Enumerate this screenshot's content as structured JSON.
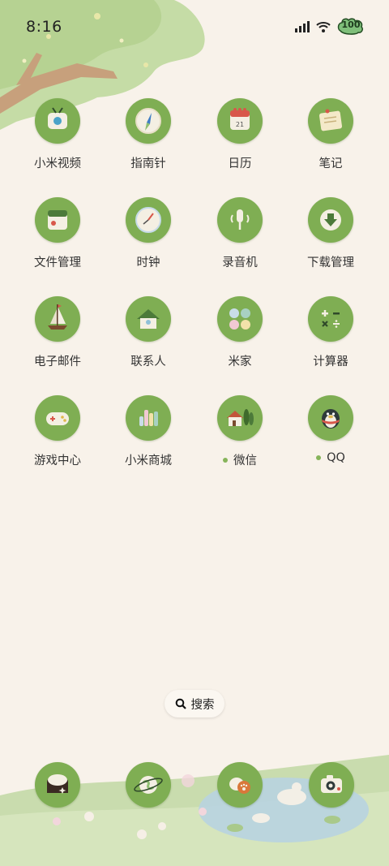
{
  "status_bar": {
    "time": "8:16",
    "battery_level": "100"
  },
  "apps": [
    {
      "label": "小米视频",
      "icon": "tv-icon"
    },
    {
      "label": "指南针",
      "icon": "compass-icon"
    },
    {
      "label": "日历",
      "icon": "calendar-icon"
    },
    {
      "label": "笔记",
      "icon": "notes-icon"
    },
    {
      "label": "文件管理",
      "icon": "folder-icon"
    },
    {
      "label": "时钟",
      "icon": "clock-icon"
    },
    {
      "label": "录音机",
      "icon": "microphone-icon"
    },
    {
      "label": "下载管理",
      "icon": "download-icon"
    },
    {
      "label": "电子邮件",
      "icon": "sailboat-icon"
    },
    {
      "label": "联系人",
      "icon": "house-icon"
    },
    {
      "label": "米家",
      "icon": "smart-home-icon"
    },
    {
      "label": "计算器",
      "icon": "calculator-icon"
    },
    {
      "label": "游戏中心",
      "icon": "gamepad-icon"
    },
    {
      "label": "小米商城",
      "icon": "shop-icon"
    },
    {
      "label": "微信",
      "icon": "wechat-cabin-icon",
      "new_badge": true
    },
    {
      "label": "QQ",
      "icon": "penguin-icon",
      "new_badge": true
    }
  ],
  "search": {
    "label": "搜索"
  },
  "dock": [
    {
      "icon": "chat-bubble-icon"
    },
    {
      "icon": "browser-planet-icon"
    },
    {
      "icon": "gallery-paw-icon"
    },
    {
      "icon": "camera-icon"
    }
  ],
  "colors": {
    "background": "#f8f2ea",
    "icon_green": "#7fae53",
    "badge_dot": "#86b45a"
  }
}
